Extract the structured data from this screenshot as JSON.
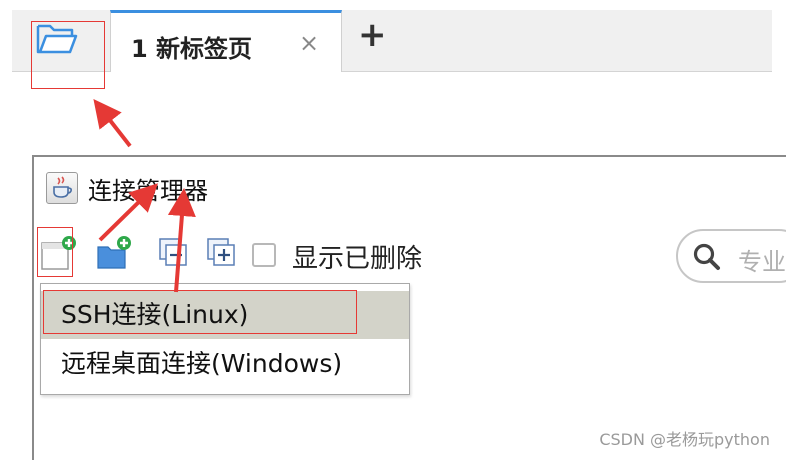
{
  "tabbar": {
    "tab_label": "1 新标签页",
    "close_glyph": "×",
    "add_glyph": "+",
    "folder_icon": "folder-open-icon"
  },
  "window": {
    "title": "连接管理器",
    "title_icon": "java-cup-icon",
    "toolbar": {
      "new_connection_icon": "new-connection-icon",
      "new_folder_icon": "new-folder-icon",
      "collapse_icon": "collapse-icon",
      "expand_icon": "expand-icon",
      "show_deleted_label": "显示已删除",
      "show_deleted_checked": false,
      "search_placeholder": "专业"
    }
  },
  "menu": {
    "items": [
      {
        "label": "SSH连接(Linux)",
        "selected": true
      },
      {
        "label": "远程桌面连接(Windows)",
        "selected": false
      }
    ]
  },
  "colors": {
    "highlight_box": "#e53935",
    "arrow": "#e53935",
    "tab_accent": "#3b8fe0",
    "menu_selected_bg": "#d3d3c9",
    "folder_blue": "#3b8fe0",
    "plus_green": "#2ea84a"
  },
  "watermark": "CSDN @老杨玩python"
}
